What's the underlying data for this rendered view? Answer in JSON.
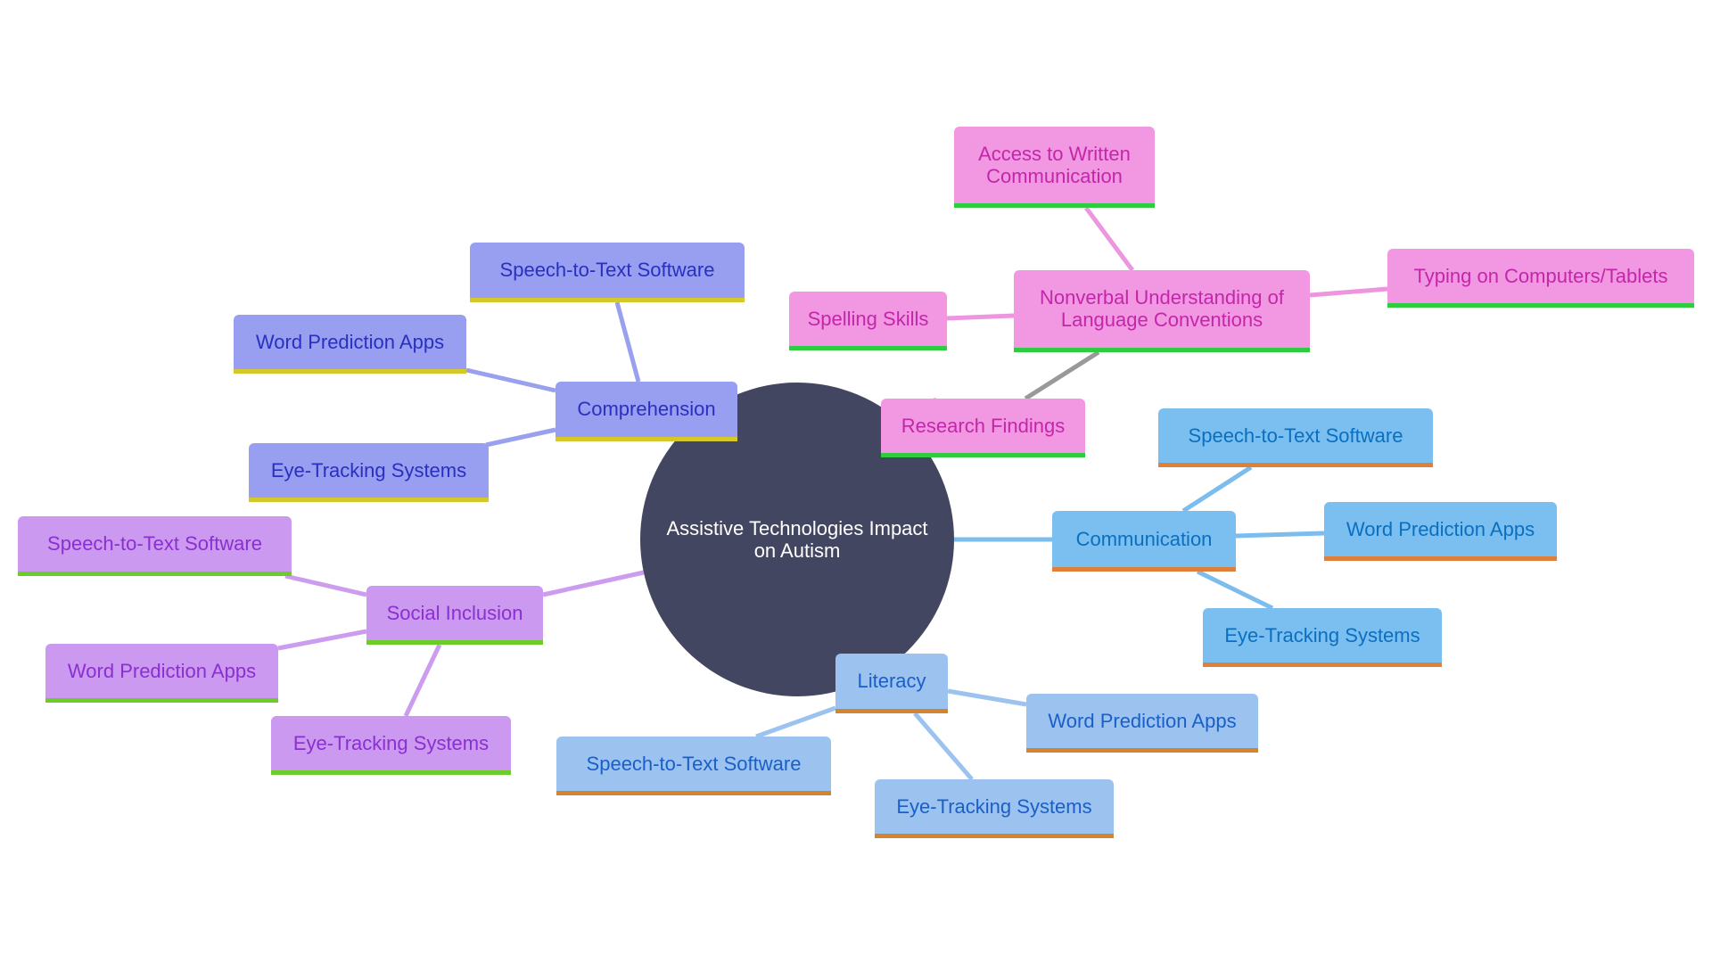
{
  "root": {
    "label": "Assistive Technologies Impact on Autism",
    "color": "#424660",
    "text_color": "#ffffff"
  },
  "branches": [
    {
      "id": "research",
      "label": "Research Findings",
      "colors": {
        "fill": "#f297e2",
        "text": "#c327a9",
        "bar": "#2ecc40",
        "edge": "#ee95e0"
      },
      "children": [],
      "sub": {
        "id": "nonverbal",
        "label": "Nonverbal Understanding of Language Conventions",
        "children": [
          {
            "id": "access",
            "label": "Access to Written Communication"
          },
          {
            "id": "spelling",
            "label": "Spelling Skills"
          },
          {
            "id": "typing",
            "label": "Typing on Computers/Tablets"
          }
        ]
      }
    },
    {
      "id": "comprehension",
      "label": "Comprehension",
      "colors": {
        "fill": "#989ff0",
        "text": "#2a2fc0",
        "bar": "#d4c82a",
        "edge": "#99a0ee"
      },
      "children": [
        {
          "id": "comp-stt",
          "label": "Speech-to-Text Software"
        },
        {
          "id": "comp-wp",
          "label": "Word Prediction Apps"
        },
        {
          "id": "comp-et",
          "label": "Eye-Tracking Systems"
        }
      ]
    },
    {
      "id": "social",
      "label": "Social Inclusion",
      "colors": {
        "fill": "#cc99f0",
        "text": "#8a2fd0",
        "bar": "#6ccc2a",
        "edge": "#cc9cef"
      },
      "children": [
        {
          "id": "soc-stt",
          "label": "Speech-to-Text Software"
        },
        {
          "id": "soc-wp",
          "label": "Word Prediction Apps"
        },
        {
          "id": "soc-et",
          "label": "Eye-Tracking Systems"
        }
      ]
    },
    {
      "id": "communication",
      "label": "Communication",
      "colors": {
        "fill": "#7bbff0",
        "text": "#0a6fc0",
        "bar": "#e07f3a",
        "edge": "#7cbdee"
      },
      "children": [
        {
          "id": "comm-stt",
          "label": "Speech-to-Text Software"
        },
        {
          "id": "comm-wp",
          "label": "Word Prediction Apps"
        },
        {
          "id": "comm-et",
          "label": "Eye-Tracking Systems"
        }
      ]
    },
    {
      "id": "literacy",
      "label": "Literacy",
      "colors": {
        "fill": "#9cc3ef",
        "text": "#1a5fc8",
        "bar": "#d4832e",
        "edge": "#9cc3ef"
      },
      "children": [
        {
          "id": "lit-wp",
          "label": "Word Prediction Apps"
        },
        {
          "id": "lit-stt",
          "label": "Speech-to-Text Software"
        },
        {
          "id": "lit-et",
          "label": "Eye-Tracking Systems"
        }
      ]
    }
  ]
}
